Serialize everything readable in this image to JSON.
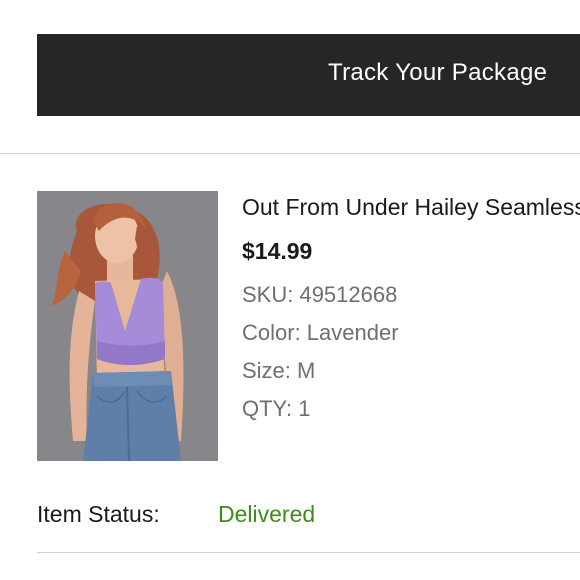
{
  "header": {
    "track_label": "Track Your Package"
  },
  "product": {
    "name": "Out From Under Hailey Seamless",
    "price": "$14.99",
    "sku": "SKU: 49512668",
    "color": "Color: Lavender",
    "size": "Size: M",
    "qty": "QTY: 1",
    "image_alt": "product-photo-lavender-top"
  },
  "status": {
    "label": "Item Status:",
    "value": "Delivered",
    "value_color": "#3f8b1e"
  },
  "colors": {
    "button_bg": "#262626",
    "divider": "#cfcfcf",
    "muted_text": "#6f6f6f"
  }
}
